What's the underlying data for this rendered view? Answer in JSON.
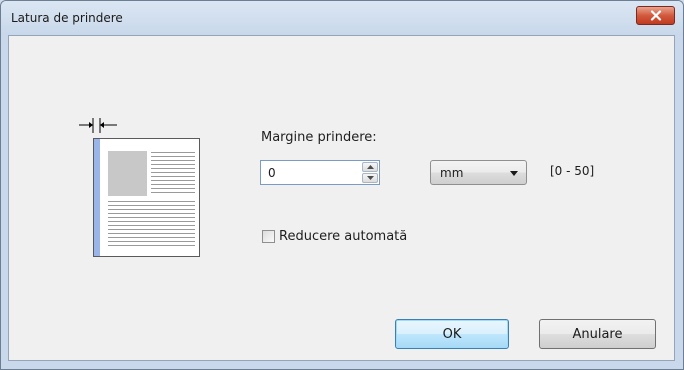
{
  "window": {
    "title": "Latura de prindere"
  },
  "binding_margin": {
    "label": "Margine prindere:",
    "value": "0",
    "unit_selected": "mm",
    "range": "[0 - 50]"
  },
  "auto_reduce": {
    "label": "Reducere automată",
    "checked": false
  },
  "buttons": {
    "ok_label": "OK",
    "cancel_label": "Anulare"
  },
  "colors": {
    "binding_edge": "#9ab6e8",
    "close_button": "#c13a1f",
    "ok_border": "#3c7fb1"
  }
}
